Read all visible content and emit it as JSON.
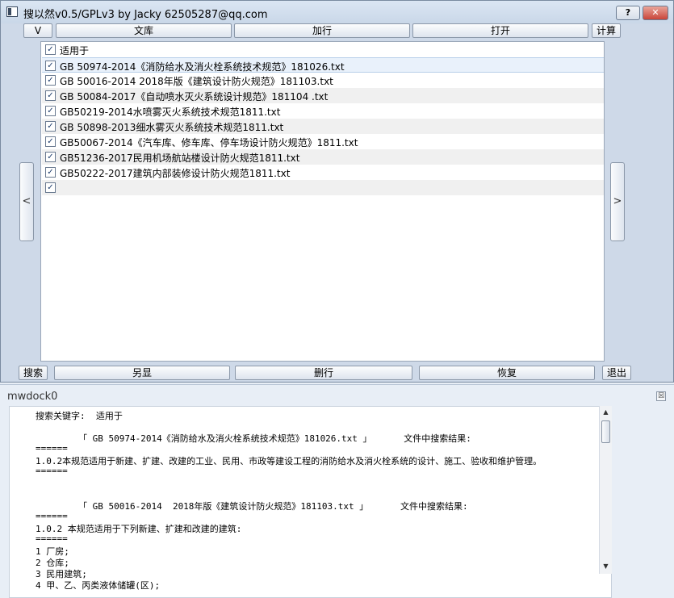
{
  "window": {
    "title": "搜以然v0.5/GPLv3 by Jacky 62505287@qq.com",
    "help_label": "?",
    "close_label": "✕"
  },
  "toolbar": {
    "v_label": "V",
    "library_label": "文库",
    "load_label": "加行",
    "open_label": "打开",
    "calc_label": "计算"
  },
  "nav": {
    "prev_label": "<",
    "next_label": ">"
  },
  "list": {
    "rows": [
      {
        "label": "适用于",
        "checked": true
      },
      {
        "label": "GB 50974-2014《消防给水及消火栓系统技术规范》181026.txt",
        "checked": true
      },
      {
        "label": "GB 50016-2014  2018年版《建筑设计防火规范》181103.txt",
        "checked": true
      },
      {
        "label": "GB 50084-2017《自动喷水灭火系统设计规范》181104 .txt",
        "checked": true
      },
      {
        "label": "GB50219-2014水喷雾灭火系统技术规范1811.txt",
        "checked": true
      },
      {
        "label": "GB 50898-2013细水雾灭火系统技术规范1811.txt",
        "checked": true
      },
      {
        "label": "GB50067-2014《汽车库、修车库、停车场设计防火规范》1811.txt",
        "checked": true
      },
      {
        "label": "GB51236-2017民用机场航站楼设计防火规范1811.txt",
        "checked": true
      },
      {
        "label": "GB50222-2017建筑内部装修设计防火规范1811.txt",
        "checked": true
      },
      {
        "label": "",
        "checked": true
      }
    ],
    "check_glyph": "✓"
  },
  "bottom": {
    "search_label": "搜索",
    "alt_show_label": "另显",
    "delete_label": "删行",
    "restore_label": "恢复",
    "exit_label": "退出"
  },
  "dock": {
    "title": "mwdock0",
    "close_label": "☒",
    "output_lines": [
      "搜索关键字:  适用于",
      "",
      "        「 GB 50974-2014《消防给水及消火栓系统技术规范》181026.txt 」      文件中搜索结果:",
      "======",
      "1.0.2本规范适用于新建、扩建、改建的工业、民用、市政等建设工程的消防给水及消火栓系统的设计、施工、验收和维护管理。",
      "======",
      "",
      "",
      "        「 GB 50016-2014  2018年版《建筑设计防火规范》181103.txt 」      文件中搜索结果:",
      "======",
      "1.0.2 本规范适用于下列新建、扩建和改建的建筑:",
      "======",
      "1 厂房;",
      "2 仓库;",
      "3 民用建筑;",
      "4 甲、乙、丙类液体储罐(区);"
    ],
    "scroll_up": "▲",
    "scroll_down": "▼"
  }
}
